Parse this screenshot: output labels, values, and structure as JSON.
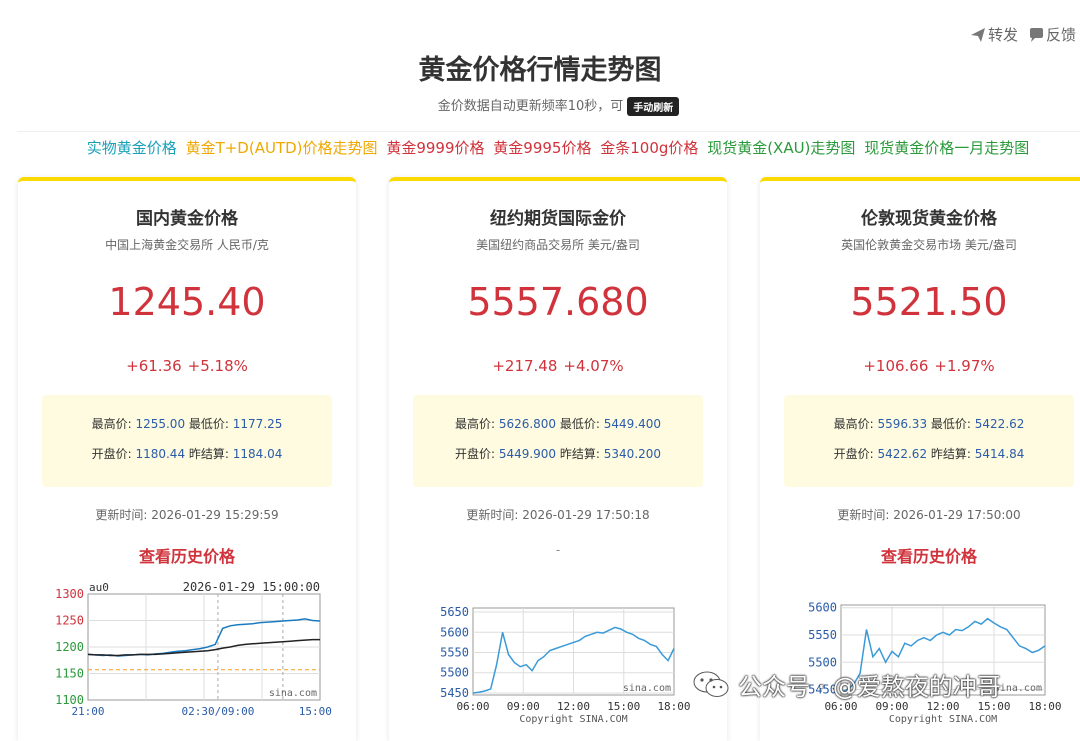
{
  "header": {
    "title": "黄金价格行情走势图",
    "subtitle": "金价数据自动更新频率10秒，可",
    "refresh_label": "手动刷新",
    "share_label": "转发",
    "feedback_label": "反馈"
  },
  "nav": [
    {
      "label": "实物黄金价格",
      "color": "#1aa0b8"
    },
    {
      "label": "黄金T+D(AUTD)价格走势图",
      "color": "#f0a800"
    },
    {
      "label": "黄金9999价格",
      "color": "#d0333c"
    },
    {
      "label": "黄金9995价格",
      "color": "#d0333c"
    },
    {
      "label": "金条100g价格",
      "color": "#d0333c"
    },
    {
      "label": "现货黄金(XAU)走势图",
      "color": "#2a9a3a"
    },
    {
      "label": "现货黄金价格一月走势图",
      "color": "#2a9a3a"
    }
  ],
  "cards": [
    {
      "title": "国内黄金价格",
      "subtitle": "中国上海黄金交易所 人民币/克",
      "price": "1245.40",
      "change": "+61.36",
      "change_pct": "+5.18%",
      "high_label": "最高价:",
      "high": "1255.00",
      "low_label": "最低价:",
      "low": "1177.25",
      "open_label": "开盘价:",
      "open": "1180.44",
      "prev_label": "昨结算:",
      "prev": "1184.04",
      "updated": "更新时间: 2026-01-29 15:29:59",
      "history_label": "查看历史价格"
    },
    {
      "title": "纽约期货国际金价",
      "subtitle": "美国纽约商品交易所 美元/盎司",
      "price": "5557.680",
      "change": "+217.48",
      "change_pct": "+4.07%",
      "high_label": "最高价:",
      "high": "5626.800",
      "low_label": "最低价:",
      "low": "5449.400",
      "open_label": "开盘价:",
      "open": "5449.900",
      "prev_label": "昨结算:",
      "prev": "5340.200",
      "updated": "更新时间: 2026-01-29 17:50:18",
      "history_label": "-"
    },
    {
      "title": "伦敦现货黄金价格",
      "subtitle": "英国伦敦黄金交易市场 美元/盎司",
      "price": "5521.50",
      "change": "+106.66",
      "change_pct": "+1.97%",
      "high_label": "最高价:",
      "high": "5596.33",
      "low_label": "最低价:",
      "low": "5422.62",
      "open_label": "开盘价:",
      "open": "5422.62",
      "prev_label": "昨结算:",
      "prev": "5414.84",
      "updated": "更新时间: 2026-01-29 17:50:00",
      "history_label": "查看历史价格"
    }
  ],
  "chart_data": [
    {
      "type": "line",
      "title": "2026-01-29 15:00:00",
      "symbol": "au0",
      "source": "sina.com",
      "x_ticks": [
        "21:00",
        "02:30/09:00",
        "15:00"
      ],
      "y_ticks": [
        "1300",
        "1250",
        "1200",
        "1150",
        "1100"
      ],
      "ylim": [
        1100,
        1300
      ],
      "reference_line": 1157,
      "series": [
        {
          "color": "#1a7ac0",
          "values": [
            1186,
            1185,
            1184,
            1185,
            1183,
            1184,
            1185,
            1186,
            1185,
            1187,
            1188,
            1190,
            1192,
            1193,
            1195,
            1197,
            1200,
            1205,
            1235,
            1240,
            1242,
            1243,
            1244,
            1246,
            1247,
            1248,
            1249,
            1250,
            1251,
            1253,
            1250,
            1249
          ]
        },
        {
          "color": "#222222",
          "values": [
            1186,
            1185,
            1185,
            1184,
            1184,
            1185,
            1185,
            1186,
            1186,
            1186,
            1187,
            1188,
            1189,
            1190,
            1191,
            1192,
            1193,
            1195,
            1198,
            1200,
            1203,
            1205,
            1206,
            1207,
            1208,
            1209,
            1210,
            1211,
            1212,
            1213,
            1214,
            1214
          ]
        }
      ]
    },
    {
      "type": "line",
      "source": "sina.com",
      "copyright": "Copyright  SINA.COM",
      "x_ticks": [
        "06:00",
        "09:00",
        "12:00",
        "15:00",
        "18:00"
      ],
      "y_ticks": [
        "5650",
        "5600",
        "5550",
        "5500",
        "5450"
      ],
      "ylim": [
        5445,
        5660
      ],
      "series": [
        {
          "color": "#3a9ad8",
          "values": [
            5450,
            5452,
            5455,
            5460,
            5520,
            5600,
            5545,
            5525,
            5515,
            5520,
            5505,
            5530,
            5540,
            5555,
            5560,
            5565,
            5570,
            5575,
            5580,
            5590,
            5595,
            5600,
            5598,
            5605,
            5612,
            5608,
            5600,
            5595,
            5585,
            5580,
            5570,
            5565,
            5545,
            5530,
            5560
          ]
        }
      ]
    },
    {
      "type": "line",
      "source": "sina.com",
      "copyright": "Copyright  SINA.COM",
      "x_ticks": [
        "06:00",
        "09:00",
        "12:00",
        "15:00",
        "18:00"
      ],
      "y_ticks": [
        "5600",
        "5550",
        "5500",
        "5450"
      ],
      "ylim": [
        5440,
        5605
      ],
      "series": [
        {
          "color": "#3a9ad8",
          "values": [
            5445,
            5450,
            5460,
            5480,
            5560,
            5510,
            5525,
            5500,
            5520,
            5510,
            5535,
            5530,
            5540,
            5545,
            5540,
            5550,
            5555,
            5550,
            5560,
            5558,
            5565,
            5575,
            5570,
            5580,
            5572,
            5565,
            5560,
            5545,
            5530,
            5525,
            5518,
            5522,
            5530
          ]
        }
      ]
    }
  ]
}
